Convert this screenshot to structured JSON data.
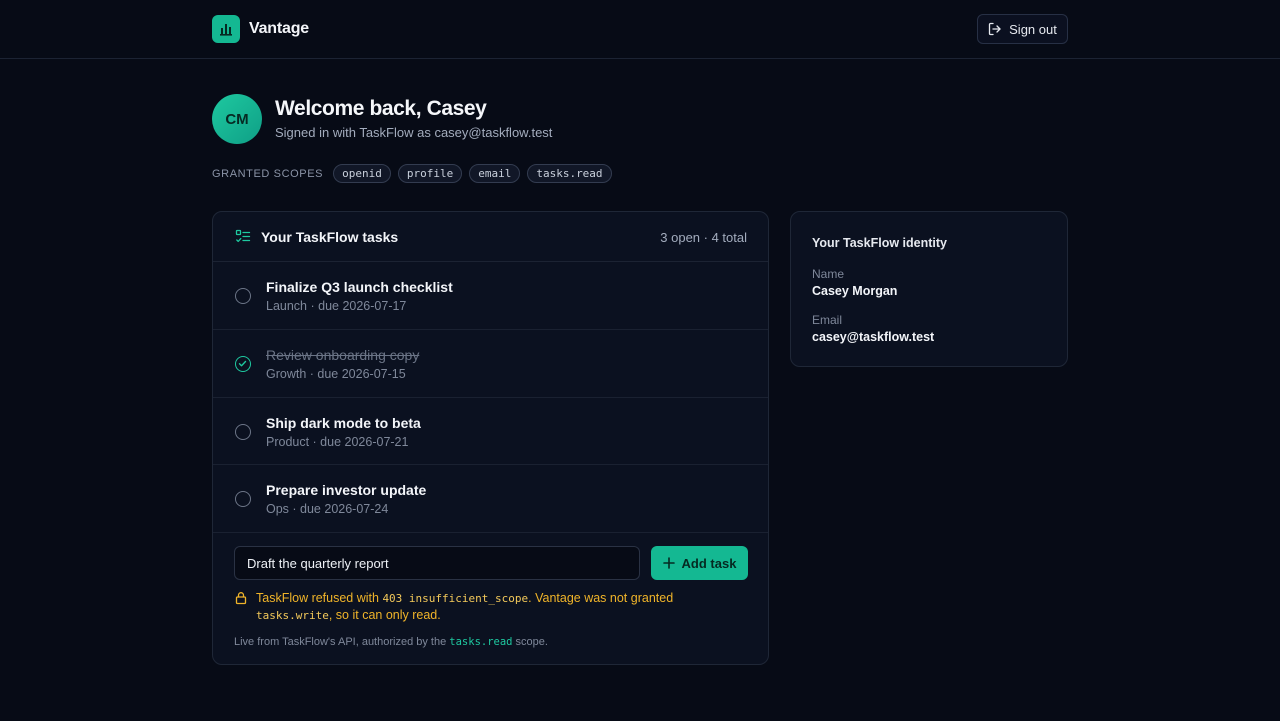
{
  "header": {
    "app_name": "Vantage",
    "signout_label": "Sign out",
    "brand_color": "#14b892"
  },
  "welcome": {
    "avatar_initials": "CM",
    "title": "Welcome back, Casey",
    "subtitle": "Signed in with TaskFlow as casey@taskflow.test"
  },
  "scopes": {
    "label": "GRANTED SCOPES",
    "items": [
      "openid",
      "profile",
      "email",
      "tasks.read"
    ]
  },
  "tasks": {
    "title": "Your TaskFlow tasks",
    "count": "3 open · 4 total",
    "items": [
      {
        "title": "Finalize Q3 launch checklist",
        "meta": "Launch · due 2026-07-17",
        "done": false
      },
      {
        "title": "Review onboarding copy",
        "meta": "Growth · due 2026-07-15",
        "done": true
      },
      {
        "title": "Ship dark mode to beta",
        "meta": "Product · due 2026-07-21",
        "done": false
      },
      {
        "title": "Prepare investor update",
        "meta": "Ops · due 2026-07-24",
        "done": false
      }
    ],
    "input_value": "Draft the quarterly report",
    "add_label": "Add task",
    "error": {
      "prefix": "TaskFlow refused with ",
      "code": "403 insufficient_scope",
      "middle": ". Vantage was not granted ",
      "scope": "tasks.write",
      "suffix": ", so it can only read."
    },
    "footer": {
      "prefix": "Live from TaskFlow's API, authorized by the ",
      "scope": "tasks.read",
      "suffix": " scope."
    }
  },
  "identity": {
    "title": "Your TaskFlow identity",
    "name_label": "Name",
    "name_value": "Casey Morgan",
    "email_label": "Email",
    "email_value": "casey@taskflow.test"
  },
  "colors": {
    "background": "#070b16",
    "accent": "#14b892",
    "warning": "#f0b429"
  }
}
